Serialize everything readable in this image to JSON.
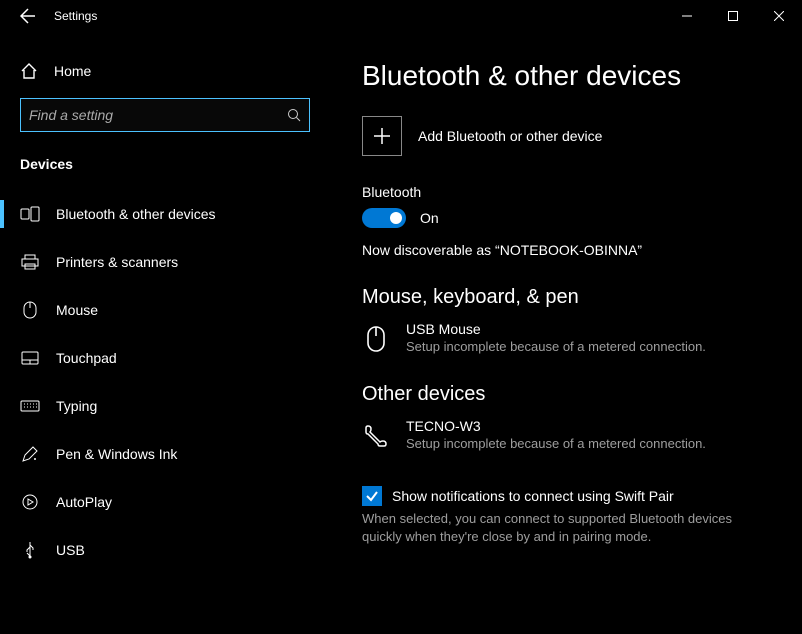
{
  "window": {
    "title": "Settings"
  },
  "sidebar": {
    "home": "Home",
    "search_placeholder": "Find a setting",
    "section": "Devices",
    "items": [
      {
        "label": "Bluetooth & other devices",
        "icon": "bluetooth-devices-icon",
        "active": true
      },
      {
        "label": "Printers & scanners",
        "icon": "printer-icon"
      },
      {
        "label": "Mouse",
        "icon": "mouse-icon"
      },
      {
        "label": "Touchpad",
        "icon": "touchpad-icon"
      },
      {
        "label": "Typing",
        "icon": "keyboard-icon"
      },
      {
        "label": "Pen & Windows Ink",
        "icon": "pen-icon"
      },
      {
        "label": "AutoPlay",
        "icon": "autoplay-icon"
      },
      {
        "label": "USB",
        "icon": "usb-icon"
      }
    ]
  },
  "main": {
    "title": "Bluetooth & other devices",
    "add_label": "Add Bluetooth or other device",
    "bluetooth": {
      "header": "Bluetooth",
      "state": "On",
      "discoverable": "Now discoverable as “NOTEBOOK-OBINNA”"
    },
    "groups": [
      {
        "title": "Mouse, keyboard, & pen",
        "devices": [
          {
            "name": "USB Mouse",
            "sub": "Setup incomplete because of a metered connection.",
            "icon": "mouse-device-icon"
          }
        ]
      },
      {
        "title": "Other devices",
        "devices": [
          {
            "name": "TECNO-W3",
            "sub": "Setup incomplete because of a metered connection.",
            "icon": "phone-icon"
          }
        ]
      }
    ],
    "swift_pair": {
      "label": "Show notifications to connect using Swift Pair",
      "desc": "When selected, you can connect to supported Bluetooth devices quickly when they're close by and in pairing mode."
    }
  }
}
